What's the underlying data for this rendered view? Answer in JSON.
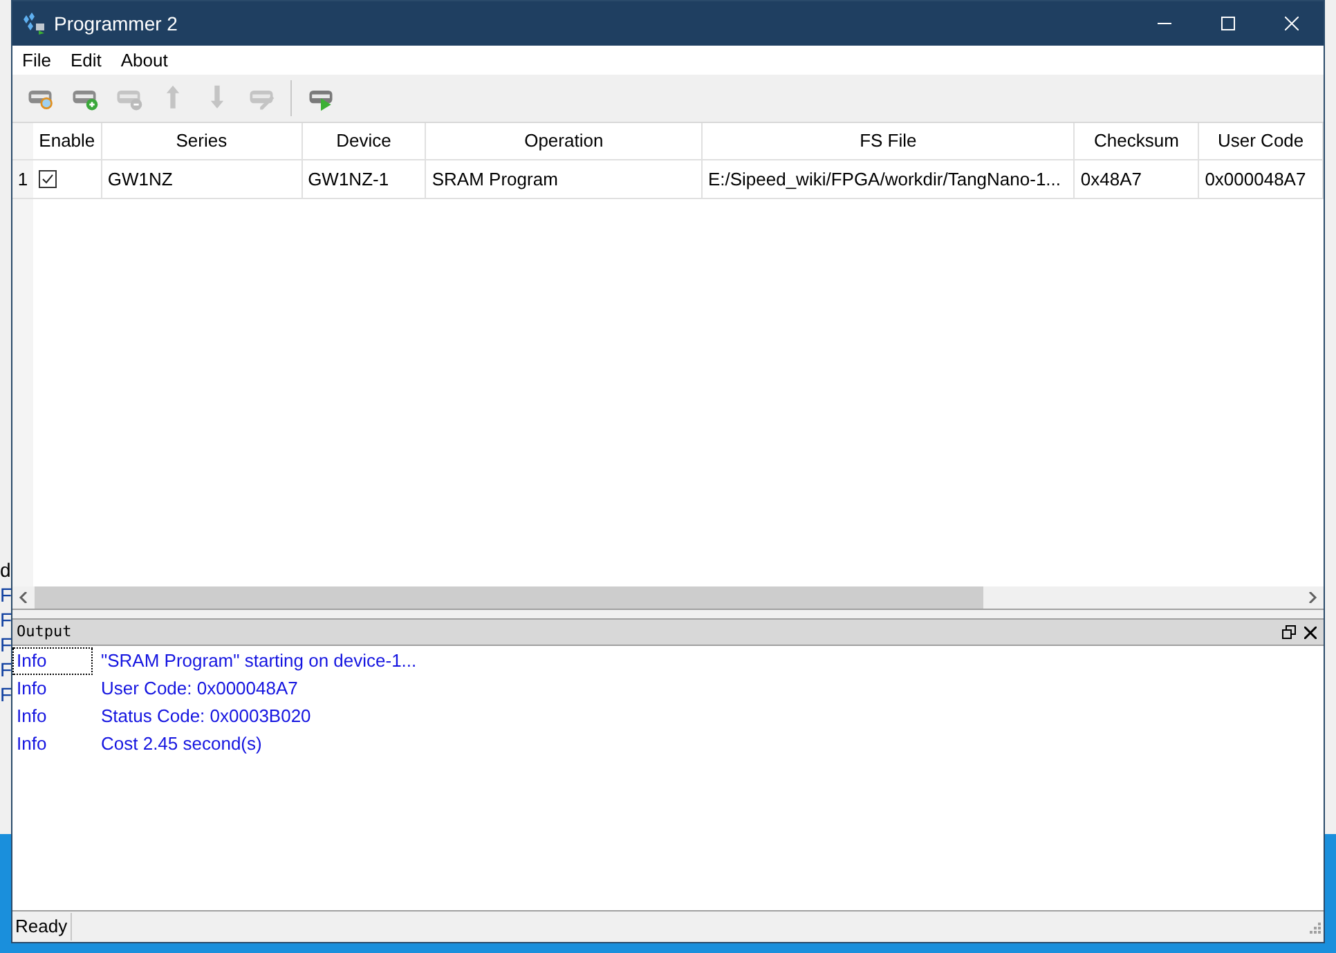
{
  "window": {
    "title": "Programmer 2"
  },
  "background_text": [
    "d",
    "F",
    "F",
    "F",
    "F",
    "F"
  ],
  "menu": [
    "File",
    "Edit",
    "About"
  ],
  "toolbar": [
    {
      "kind": "scan",
      "disabled": false
    },
    {
      "kind": "add",
      "disabled": false
    },
    {
      "kind": "remove",
      "disabled": true
    },
    {
      "kind": "up",
      "disabled": true
    },
    {
      "kind": "down",
      "disabled": true
    },
    {
      "kind": "edit",
      "disabled": true
    },
    {
      "kind": "separator"
    },
    {
      "kind": "program",
      "disabled": false
    }
  ],
  "table": {
    "columns": [
      "Enable",
      "Series",
      "Device",
      "Operation",
      "FS File",
      "Checksum",
      "User Code"
    ],
    "rows": [
      {
        "number": "1",
        "cells": [
          {
            "kind": "checkbox",
            "checked": true
          },
          {
            "kind": "text",
            "text": "GW1NZ"
          },
          {
            "kind": "text",
            "text": "GW1NZ-1"
          },
          {
            "kind": "text",
            "text": "SRAM Program"
          },
          {
            "kind": "text",
            "text": "E:/Sipeed_wiki/FPGA/workdir/TangNano-1..."
          },
          {
            "kind": "text",
            "text": "0x48A7"
          },
          {
            "kind": "text",
            "text": "0x000048A7"
          }
        ]
      }
    ]
  },
  "output": {
    "title": "Output",
    "lines": [
      {
        "level": "Info",
        "message": "\"SRAM Program\" starting on device-1...",
        "selected": true
      },
      {
        "level": "Info",
        "message": "User Code: 0x000048A7",
        "selected": false
      },
      {
        "level": "Info",
        "message": "Status Code: 0x0003B020",
        "selected": false
      },
      {
        "level": "Info",
        "message": "Cost 2.45 second(s)",
        "selected": false
      }
    ]
  },
  "status_bar": "Ready"
}
